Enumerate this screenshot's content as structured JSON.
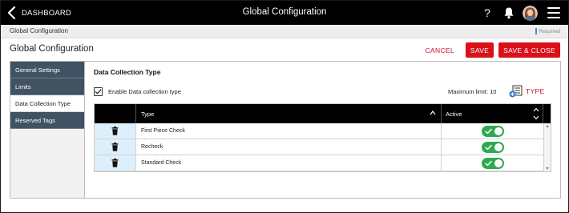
{
  "topbar": {
    "back_label": "DASHBOARD",
    "title": "Global Configuration",
    "help_glyph": "?",
    "icons": [
      "back-chevron-icon",
      "help-icon",
      "bell-icon",
      "avatar",
      "hamburger-menu-icon"
    ]
  },
  "breadcrumb": {
    "path": "Global Configuration",
    "required_legend": "Required"
  },
  "header": {
    "title": "Global Configuration",
    "cancel_label": "CANCEL",
    "save_label": "SAVE",
    "save_close_label": "SAVE & CLOSE"
  },
  "sidebar": {
    "items": [
      {
        "label": "General Settings",
        "active": false
      },
      {
        "label": "Limits",
        "active": false
      },
      {
        "label": "Data Collection Type",
        "active": true
      },
      {
        "label": "Reserved Tags",
        "active": false
      }
    ]
  },
  "content": {
    "section_title": "Data Collection Type",
    "enable_checkbox": {
      "label": "Enable Data collection type",
      "checked": true
    },
    "max_limit_text": "Maximum limit: 10",
    "type_button_label": "TYPE",
    "type_button_icon": "add-list-icon"
  },
  "table": {
    "columns": {
      "type": "Type",
      "active": "Active"
    },
    "rows": [
      {
        "type": "First Piece Check",
        "active": true
      },
      {
        "type": "Recheck",
        "active": true
      },
      {
        "type": "Standard Check",
        "active": true
      }
    ]
  },
  "colors": {
    "accent_red": "#d8111b",
    "sidebar_bg": "#415263",
    "toggle_on": "#2fa84f",
    "delete_cell_bg": "#ddeffa"
  }
}
